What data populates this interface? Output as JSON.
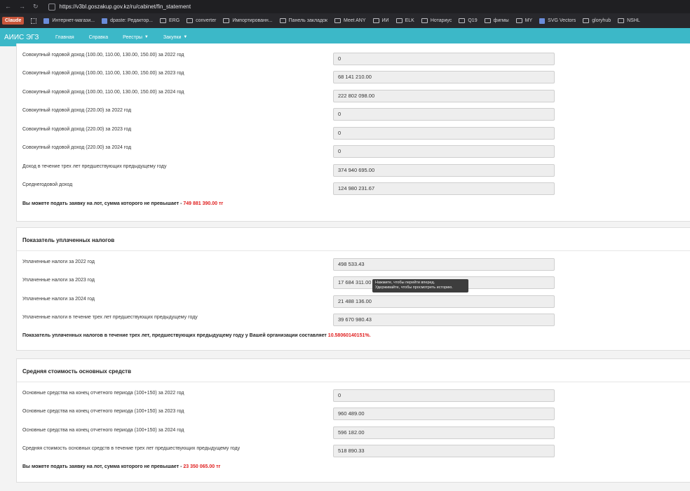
{
  "browser": {
    "url": "https://v3bl.goszakup.gov.kz/ru/cabinet/fin_statement",
    "bookmarks": [
      {
        "label": "Claude",
        "kind": "claude"
      },
      {
        "label": "Интернет-магази...",
        "kind": "fav"
      },
      {
        "label": "dpaste: Редактор...",
        "kind": "fav"
      },
      {
        "label": "ERG",
        "kind": "folder"
      },
      {
        "label": "converter",
        "kind": "folder"
      },
      {
        "label": "Импортированн...",
        "kind": "folder"
      },
      {
        "label": "Панель закладок",
        "kind": "folder"
      },
      {
        "label": "Meet ANY",
        "kind": "folder"
      },
      {
        "label": "ИИ",
        "kind": "folder"
      },
      {
        "label": "ELK",
        "kind": "folder"
      },
      {
        "label": "Нотариус",
        "kind": "folder"
      },
      {
        "label": "Q19",
        "kind": "folder"
      },
      {
        "label": "фигмы",
        "kind": "folder"
      },
      {
        "label": "MY",
        "kind": "folder"
      },
      {
        "label": "SVG Vectors",
        "kind": "fav"
      },
      {
        "label": "gloryhub",
        "kind": "folder"
      },
      {
        "label": "NSHL",
        "kind": "folder"
      }
    ]
  },
  "appbar": {
    "brand": "АИИС ЭГЗ",
    "menu": [
      "Главная",
      "Справка",
      "Реестры",
      "Закупки"
    ]
  },
  "income": {
    "rows": [
      {
        "label": "Совокупный годовой доход (100.00, 110.00, 130.00, 150.00) за 2022 год",
        "value": "0"
      },
      {
        "label": "Совокупный годовой доход (100.00, 110.00, 130.00, 150.00) за 2023 год",
        "value": "68 141 210.00"
      },
      {
        "label": "Совокупный годовой доход (100.00, 110.00, 130.00, 150.00) за 2024 год",
        "value": "222 802 098.00"
      },
      {
        "label": "Совокупный годовой доход (220.00) за 2022 год",
        "value": "0"
      },
      {
        "label": "Совокупный годовой доход (220.00) за 2023 год",
        "value": "0"
      },
      {
        "label": "Совокупный годовой доход (220.00) за 2024 год",
        "value": "0"
      },
      {
        "label": "Доход в течение трех лет предшествующих предыдущему году",
        "value": "374 940 695.00"
      },
      {
        "label": "Среднегодовой доход",
        "value": "124 980 231.67"
      }
    ],
    "note_prefix": "Вы можете подать заявку на лот, сумма которого не превышает - ",
    "note_value": "749 881 390.00 тг"
  },
  "taxes": {
    "title": "Показатель уплаченных налогов",
    "rows": [
      {
        "label": "Уплаченные налоги за 2022 год",
        "value": "498 533.43"
      },
      {
        "label": "Уплаченные налоги за 2023 год",
        "value": "17 684 311.00"
      },
      {
        "label": "Уплаченные налоги за 2024 год",
        "value": "21 488 136.00"
      },
      {
        "label": "Уплаченные налоги в течение трех лет предшествующих предыдущему году",
        "value": "39 670 980.43"
      }
    ],
    "note_prefix": "Показатель уплаченных налогов в течение трех лет, предшествующих предыдущему году у Вашей организации составляет ",
    "note_value": "10.58060140151%."
  },
  "assets": {
    "title": "Средняя стоимость основных средств",
    "rows": [
      {
        "label": "Основные средства на конец отчетного периода (100+150) за 2022 год",
        "value": "0"
      },
      {
        "label": "Основные средства на конец отчетного периода (100+150) за 2023 год",
        "value": "960 489.00"
      },
      {
        "label": "Основные средства на конец отчетного периода (100+150) за 2024 год",
        "value": "596 182.00"
      },
      {
        "label": "Средняя стоимость основных средств в течение трех лет предшествующих предыдущему году",
        "value": "518 890.33"
      }
    ],
    "note_prefix": "Вы можете подать заявку на лот, сумма которого не превышает - ",
    "note_value": "23 350 065.00 тг"
  },
  "tooltip": {
    "line1": "Нажмите, чтобы перейти вперед.",
    "line2": "Удерживайте, чтобы просмотреть историю."
  }
}
